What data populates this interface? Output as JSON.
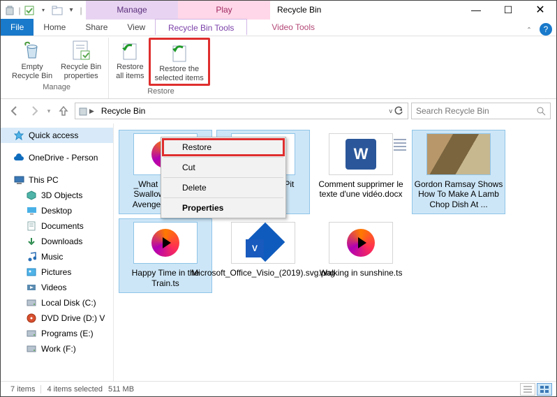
{
  "window": {
    "title": "Recycle Bin"
  },
  "ctx_tabs": {
    "manage": "Manage",
    "play": "Play"
  },
  "ribbon_tabs": {
    "file": "File",
    "home": "Home",
    "share": "Share",
    "view": "View",
    "recycle_tools": "Recycle Bin Tools",
    "video_tools": "Video Tools"
  },
  "ribbon": {
    "manage_group": "Manage",
    "restore_group": "Restore",
    "empty": "Empty\nRecycle Bin",
    "props": "Recycle Bin\nproperties",
    "restore_all": "Restore\nall items",
    "restore_sel": "Restore the\nselected items"
  },
  "nav": {
    "breadcrumb": "Recycle Bin",
    "search_placeholder": "Search Recycle Bin"
  },
  "sidebar": {
    "items": [
      {
        "label": "Quick access",
        "icon": "star",
        "cls": "quick"
      },
      {
        "label": "OneDrive - Person",
        "icon": "cloud"
      },
      {
        "label": "This PC",
        "icon": "pc"
      },
      {
        "label": "3D Objects",
        "icon": "cube",
        "lvl": 2
      },
      {
        "label": "Desktop",
        "icon": "desktop",
        "lvl": 2
      },
      {
        "label": "Documents",
        "icon": "doc",
        "lvl": 2
      },
      {
        "label": "Downloads",
        "icon": "down",
        "lvl": 2
      },
      {
        "label": "Music",
        "icon": "music",
        "lvl": 2
      },
      {
        "label": "Pictures",
        "icon": "pic",
        "lvl": 2
      },
      {
        "label": "Videos",
        "icon": "vid",
        "lvl": 2
      },
      {
        "label": "Local Disk (C:)",
        "icon": "disk",
        "lvl": 2
      },
      {
        "label": "DVD Drive (D:) V",
        "icon": "dvd",
        "lvl": 2
      },
      {
        "label": "Programs (E:)",
        "icon": "disk",
        "lvl": 2
      },
      {
        "label": "Work (F:)",
        "icon": "disk",
        "lvl": 2
      }
    ]
  },
  "files": [
    {
      "name": "_What M Want N Swallow It__ The Avengers (2012...",
      "type": "video",
      "sel": true
    },
    {
      "name": "n oy the BBQ Pit Boys.mp4",
      "type": "video",
      "sel": true
    },
    {
      "name": "Comment supprimer le texte d'une vidéo.docx",
      "type": "docx",
      "sel": false
    },
    {
      "name": "Gordon Ramsay Shows How To Make A Lamb Chop Dish At ...",
      "type": "image",
      "sel": true
    },
    {
      "name": "Happy Time in the Train.ts",
      "type": "video",
      "sel": true
    },
    {
      "name": "Microsoft_Office_Visio_(2019).svg.png",
      "type": "visio",
      "sel": false
    },
    {
      "name": "Walking in sunshine.ts",
      "type": "video",
      "sel": false
    }
  ],
  "context_menu": {
    "restore": "Restore",
    "cut": "Cut",
    "delete": "Delete",
    "properties": "Properties"
  },
  "status": {
    "count": "7 items",
    "selected": "4 items selected",
    "size": "511 MB"
  }
}
